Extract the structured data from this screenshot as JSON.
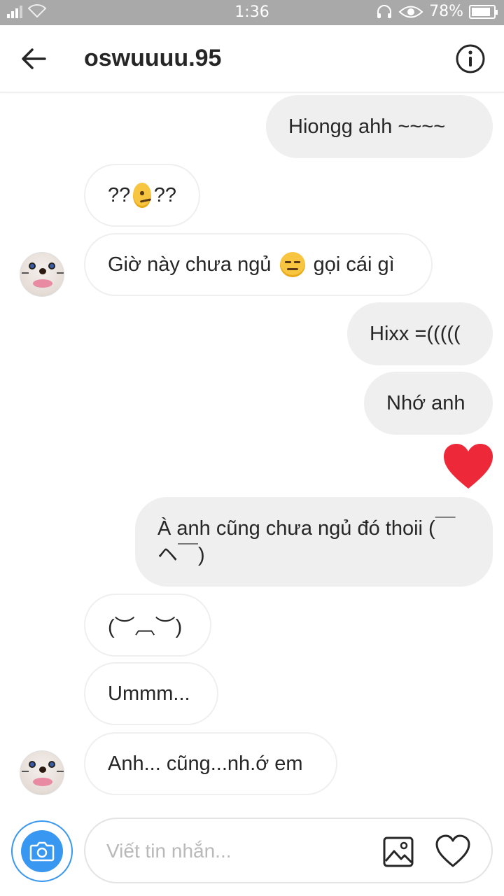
{
  "status_bar": {
    "time": "1:36",
    "battery": "78%"
  },
  "header": {
    "title": "oswuuuu.95"
  },
  "messages": [
    {
      "from": "me",
      "text": "Hiongg ahh ~~~~"
    },
    {
      "from": "them",
      "pre": "??",
      "emoji": "confused-face",
      "post": "??"
    },
    {
      "from": "them",
      "pre": "Giờ này chưa ngủ ",
      "emoji": "expressionless-face",
      "post": " gọi cái gì"
    },
    {
      "from": "me",
      "text": "Hixx =((((("
    },
    {
      "from": "me",
      "text": "Nhớ anh"
    },
    {
      "from": "me",
      "type": "heart-sticker",
      "icon": "heart-icon",
      "color": "#ed2939"
    },
    {
      "from": "me",
      "text": "À anh cũng chưa ngủ đó thoii (￣ヘ￣)"
    },
    {
      "from": "them",
      "text": "(︶︹︶)"
    },
    {
      "from": "them",
      "text": "Ummm..."
    },
    {
      "from": "them",
      "text": "Anh... cũng...nh.ớ em"
    }
  ],
  "composer": {
    "placeholder": "Viết tin nhắn..."
  },
  "colors": {
    "accent": "#3897f0",
    "bubble_me": "#efefef",
    "heart": "#ed2939"
  }
}
